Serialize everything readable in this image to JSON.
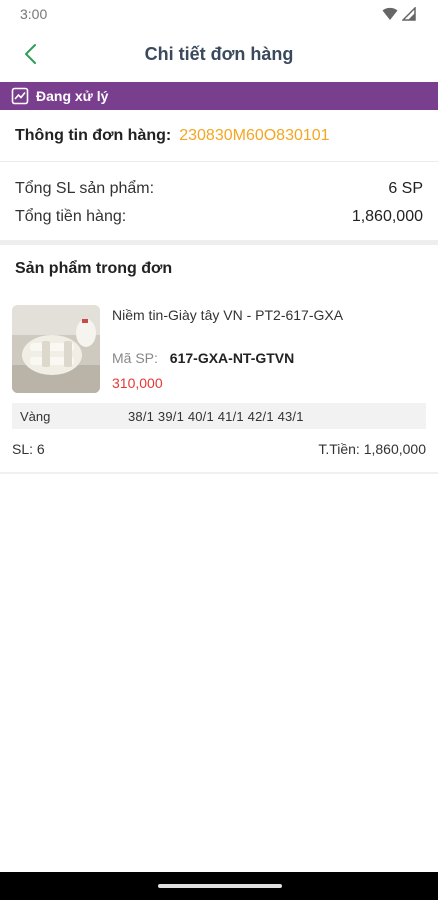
{
  "status_bar": {
    "time": "3:00",
    "wifi_icon": "wifi-icon",
    "signal_icon": "signal-icon"
  },
  "header": {
    "title": "Chi tiết đơn hàng",
    "back_icon": "chevron-left-icon"
  },
  "status_banner": {
    "label": "Đang xử lý",
    "icon": "chart-icon",
    "color": "#7a3e8f"
  },
  "order_info": {
    "label": "Thông tin đơn hàng:",
    "code": "230830M60O830101",
    "code_color": "#f4a623"
  },
  "summary": {
    "total_qty_label": "Tổng SL sản phẩm:",
    "total_qty_value": "6 SP",
    "total_amount_label": "Tổng tiền hàng:",
    "total_amount_value": "1,860,000"
  },
  "products_section": {
    "title": "Sản phẩm trong đơn",
    "items": [
      {
        "name": "Niềm tin-Giày tây VN - PT2-617-GXA",
        "sku_label": "Mã SP:",
        "sku": "617-GXA-NT-GTVN",
        "price": "310,000",
        "price_color": "#e53935",
        "variant_color": "Vàng",
        "variant_sizes": "38/1 39/1 40/1 41/1 42/1 43/1",
        "qty": "SL: 6",
        "total": "T.Tiền: 1,860,000"
      }
    ]
  }
}
